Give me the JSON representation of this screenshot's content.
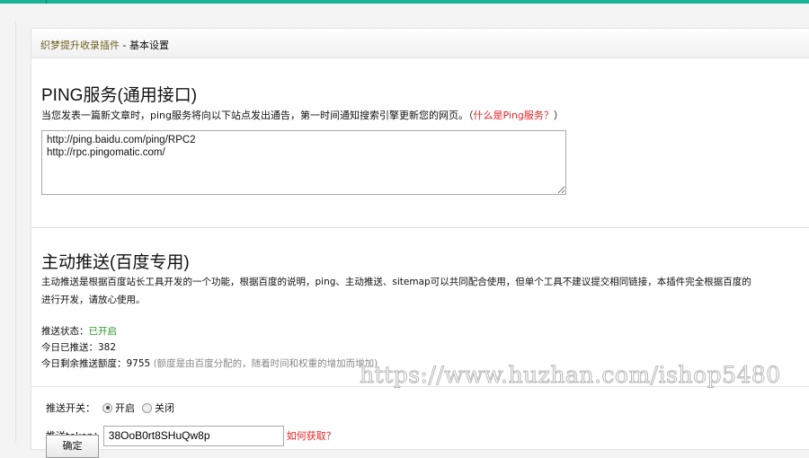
{
  "header": {
    "plugin": "织梦提升收录插件",
    "sep": " - ",
    "page": "基本设置"
  },
  "ping": {
    "title": "PING服务(通用接口)",
    "desc": "当您发表一篇新文章时，ping服务将向以下站点发出通告，第一时间通知搜索引擎更新您的网页。（",
    "link": "什么是Ping服务？",
    "desc_end": "）",
    "urls": "http://ping.baidu.com/ping/RPC2\nhttp://rpc.pingomatic.com/"
  },
  "push": {
    "title": "主动推送(百度专用)",
    "desc": "主动推送是根据百度站长工具开发的一个功能，根据百度的说明，ping、主动推送、sitemap可以共同配合使用，但单个工具不建议提交相同链接，本插件完全根据百度的",
    "desc2": "进行开发，请放心使用。",
    "status_label": "推送状态：",
    "status_value": "已开启",
    "today_label": "今日已推送：",
    "today_value": "382",
    "quota_label": "今日剩余推送额度：",
    "quota_value": "9755",
    "quota_note": "(额度是由百度分配的，随着时间和权重的增加而增加)"
  },
  "form": {
    "switch_label": "推送开关：",
    "on": "开启",
    "off": "关闭",
    "token_label": "推送token：",
    "token": "38OoB0rt8SHuQw8p",
    "how": "如何获取？",
    "submit": "确定"
  },
  "watermark": "https://www.huzhan.com/ishop5480"
}
